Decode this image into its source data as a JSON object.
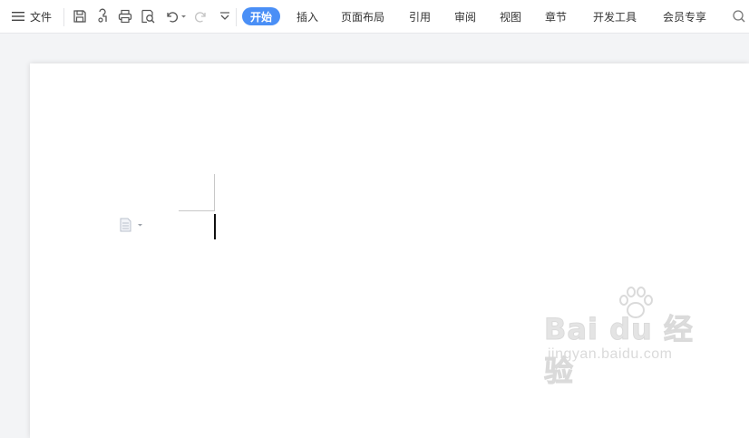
{
  "toolbar": {
    "menu_label": "文件",
    "quick_icons": [
      "save-icon",
      "format-painter-icon",
      "print-icon",
      "print-preview-icon",
      "undo-icon",
      "redo-icon",
      "more-icon"
    ],
    "tabs": [
      {
        "label": "开始",
        "active": true
      },
      {
        "label": "插入"
      },
      {
        "label": "页面布局"
      },
      {
        "label": "引用"
      },
      {
        "label": "审阅"
      },
      {
        "label": "视图"
      },
      {
        "label": "章节"
      },
      {
        "label": "开发工具"
      },
      {
        "label": "会员专享"
      }
    ],
    "search_icon": "search-icon"
  },
  "document": {
    "content": ""
  },
  "watermark": {
    "logo_text": "Bai du 经验",
    "url": "jingyan.baidu.com"
  },
  "colors": {
    "accent": "#4a8ff6",
    "toolbar_bg": "#ffffff",
    "canvas_bg": "#f3f4f6",
    "page_bg": "#ffffff"
  }
}
